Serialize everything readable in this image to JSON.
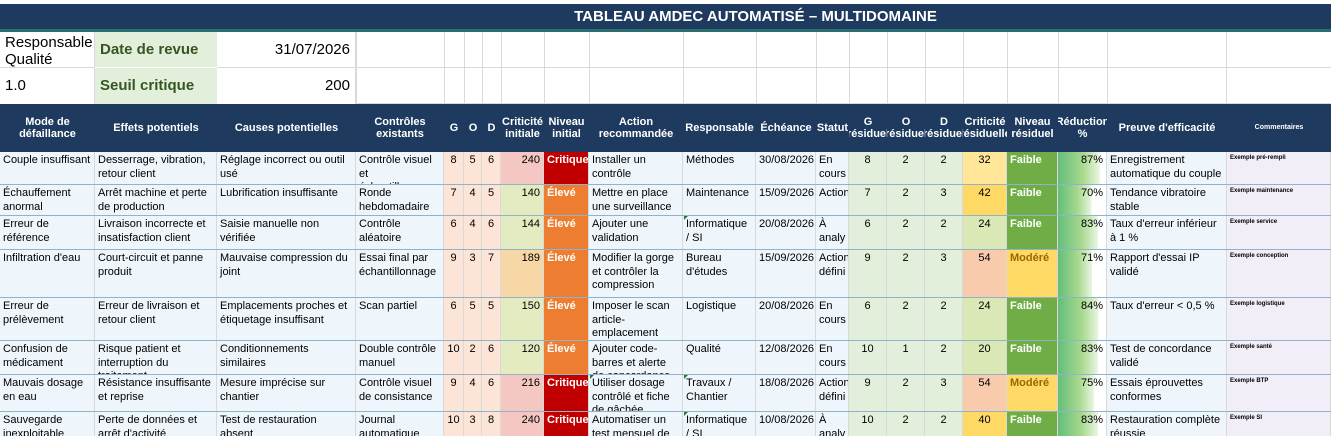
{
  "title": "TABLEAU AMDEC AUTOMATISÉ – MULTIDOMAINE",
  "meta": {
    "responsable_label": "Responsable Qualité",
    "version": "1.0",
    "date_label": "Date de revue",
    "date_value": "31/07/2026",
    "seuil_label": "Seuil critique",
    "seuil_value": "200"
  },
  "headers": [
    "Mode de défaillance",
    "Effets potentiels",
    "Causes potentielles",
    "Contrôles existants",
    "G",
    "O",
    "D",
    "Criticité initiale",
    "Niveau initial",
    "Action recommandée",
    "Responsable",
    "Échéance",
    "Statut",
    "G résiduel",
    "O résiduel",
    "D résiduel",
    "Criticité résiduelle",
    "Niveau résiduel",
    "Réduction %",
    "Preuve d'efficacité",
    "Commentaires"
  ],
  "colors": {
    "header_bg": "#1f3a5f",
    "critique": "#c00000",
    "eleve": "#ed7d31",
    "faible": "#70ad47",
    "modere": "#ffd966",
    "modere_text": "#9c6500"
  },
  "rows": [
    {
      "mode": "Couple insuffisant",
      "effets": "Desserrage, vibration, retour client",
      "causes": "Réglage incorrect ou outil usé",
      "controles": "Contrôle visuel et échantillonnage",
      "g": "8",
      "o": "5",
      "d": "6",
      "crit": "240",
      "niveau": "Critique",
      "niveau_type": "critique",
      "action": "Installer un contrôle",
      "resp": "Méthodes",
      "echeance": "30/08/2026",
      "statut": "En cours",
      "gr": "8",
      "or": "2",
      "dr": "2",
      "critr": "32",
      "nivr": "Faible",
      "nivr_type": "faible",
      "reduc": "87%",
      "reduc_frac": 0.87,
      "preuve": "Enregistrement automatique du couple",
      "comment": "Exemple pré-rempli"
    },
    {
      "mode": "Échauffement anormal",
      "effets": "Arrêt machine et perte de production",
      "causes": "Lubrification insuffisante",
      "controles": "Ronde hebdomadaire",
      "g": "7",
      "o": "4",
      "d": "5",
      "crit": "140",
      "niveau": "Élevé",
      "niveau_type": "eleve",
      "action": "Mettre en place une surveillance",
      "resp": "Maintenance",
      "echeance": "15/09/2026",
      "statut": "Action",
      "gr": "7",
      "or": "2",
      "dr": "3",
      "critr": "42",
      "nivr": "Faible",
      "nivr_type": "faible",
      "reduc": "70%",
      "reduc_frac": 0.7,
      "preuve": "Tendance vibratoire stable",
      "comment": "Exemple maintenance"
    },
    {
      "mode": "Erreur de référence",
      "effets": "Livraison incorrecte et insatisfaction client",
      "causes": "Saisie manuelle non vérifiée",
      "controles": "Contrôle aléatoire",
      "g": "6",
      "o": "4",
      "d": "6",
      "crit": "144",
      "niveau": "Élevé",
      "niveau_type": "eleve",
      "action": "Ajouter une validation",
      "resp": "Informatique / SI",
      "echeance": "20/08/2026",
      "statut": "À analy",
      "gr": "6",
      "or": "2",
      "dr": "2",
      "critr": "24",
      "nivr": "Faible",
      "nivr_type": "faible",
      "reduc": "83%",
      "reduc_frac": 0.83,
      "preuve": "Taux d'erreur inférieur à 1 %",
      "comment": "Exemple service"
    },
    {
      "mode": "Infiltration d'eau",
      "effets": "Court-circuit et panne produit",
      "causes": "Mauvaise compression du joint",
      "controles": "Essai final par échantillonnage",
      "g": "9",
      "o": "3",
      "d": "7",
      "crit": "189",
      "niveau": "Élevé",
      "niveau_type": "eleve",
      "action": "Modifier la gorge et contrôler la compression",
      "resp": "Bureau d'études",
      "echeance": "15/09/2026",
      "statut": "Action défini",
      "gr": "9",
      "or": "2",
      "dr": "3",
      "critr": "54",
      "nivr": "Modéré",
      "nivr_type": "modere",
      "reduc": "71%",
      "reduc_frac": 0.71,
      "preuve": "Rapport d'essai IP validé",
      "comment": "Exemple conception"
    },
    {
      "mode": "Erreur de prélèvement",
      "effets": "Erreur de livraison et retour client",
      "causes": "Emplacements proches et étiquetage insuffisant",
      "controles": "Scan partiel",
      "g": "6",
      "o": "5",
      "d": "5",
      "crit": "150",
      "niveau": "Élevé",
      "niveau_type": "eleve",
      "action": "Imposer le scan article-emplacement",
      "resp": "Logistique",
      "echeance": "20/08/2026",
      "statut": "En cours",
      "gr": "6",
      "or": "2",
      "dr": "2",
      "critr": "24",
      "nivr": "Faible",
      "nivr_type": "faible",
      "reduc": "84%",
      "reduc_frac": 0.84,
      "preuve": "Taux d'erreur < 0,5 %",
      "comment": "Exemple logistique"
    },
    {
      "mode": "Confusion de médicament",
      "effets": "Risque patient et interruption du traitement",
      "causes": "Conditionnements similaires",
      "controles": "Double contrôle manuel",
      "g": "10",
      "o": "2",
      "d": "6",
      "crit": "120",
      "niveau": "Élevé",
      "niveau_type": "eleve",
      "action": "Ajouter code-barres et alerte de concordance",
      "resp": "Qualité",
      "echeance": "12/08/2026",
      "statut": "En cours",
      "gr": "10",
      "or": "1",
      "dr": "2",
      "critr": "20",
      "nivr": "Faible",
      "nivr_type": "faible",
      "reduc": "83%",
      "reduc_frac": 0.83,
      "preuve": "Test de concordance validé",
      "comment": "Exemple santé"
    },
    {
      "mode": "Mauvais dosage en eau",
      "effets": "Résistance insuffisante et reprise",
      "causes": "Mesure imprécise sur chantier",
      "controles": "Contrôle visuel de consistance",
      "g": "9",
      "o": "4",
      "d": "6",
      "crit": "216",
      "niveau": "Critique",
      "niveau_type": "critique",
      "action": "Utiliser dosage contrôlé et fiche de gâchée",
      "resp": "Travaux / Chantier",
      "echeance": "18/08/2026",
      "statut": "Action défini",
      "gr": "9",
      "or": "2",
      "dr": "3",
      "critr": "54",
      "nivr": "Modéré",
      "nivr_type": "modere",
      "reduc": "75%",
      "reduc_frac": 0.75,
      "preuve": "Essais éprouvettes conformes",
      "comment": "Exemple BTP"
    },
    {
      "mode": "Sauvegarde inexploitable",
      "effets": "Perte de données et arrêt d'activité",
      "causes": "Test de restauration absent",
      "controles": "Journal automatique",
      "g": "10",
      "o": "3",
      "d": "8",
      "crit": "240",
      "niveau": "Critique",
      "niveau_type": "critique",
      "action": "Automatiser un test mensuel de restauration",
      "resp": "Informatique / SI",
      "echeance": "10/08/2026",
      "statut": "À analy",
      "gr": "10",
      "or": "2",
      "dr": "2",
      "critr": "40",
      "nivr": "Faible",
      "nivr_type": "faible",
      "reduc": "83%",
      "reduc_frac": 0.83,
      "preuve": "Restauration complète réussie",
      "comment": "Exemple SI"
    }
  ]
}
